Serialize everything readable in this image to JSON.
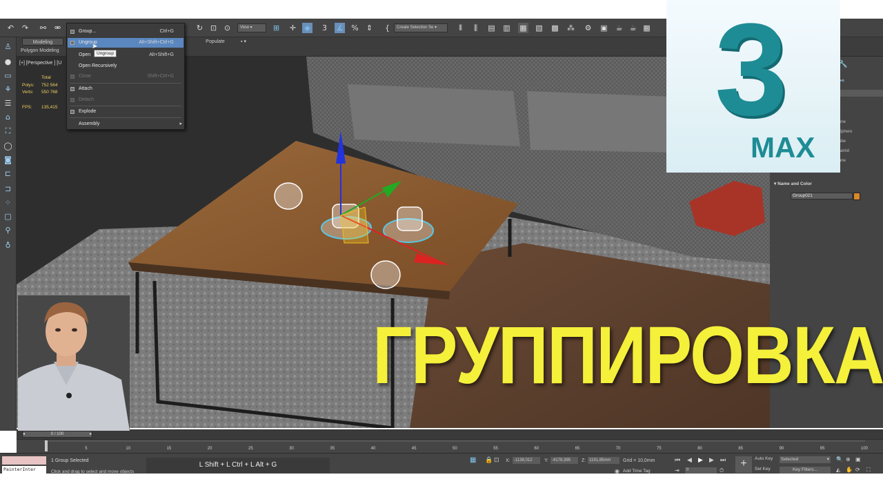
{
  "toolbar": {
    "view_select": "View",
    "selection_set": "Create Selection Se"
  },
  "ribbon": {
    "tab_modeling": "Modeling",
    "tab_populate": "Populate",
    "sub_polygon_modeling": "Polygon Modeling"
  },
  "viewport": {
    "label": "[+] [Perspective ] [U",
    "stats": {
      "header_total": "Total",
      "polys_label": "Polys:",
      "polys_value": "752 564",
      "verts_label": "Verts:",
      "verts_value": "550 768",
      "fps_label": "FPS:",
      "fps_value": "135,415"
    }
  },
  "group_menu": {
    "items": [
      {
        "label": "Group...",
        "shortcut": "Ctrl+G",
        "enabled": true,
        "highlighted": false
      },
      {
        "label": "Ungroup",
        "shortcut": "Alt+Shift+Ctrl+G",
        "enabled": true,
        "highlighted": true
      },
      {
        "label": "Open",
        "shortcut": "Alt+Shift+G",
        "enabled": true,
        "highlighted": false
      },
      {
        "label": "Open Recursively",
        "shortcut": "",
        "enabled": true,
        "highlighted": false
      },
      {
        "label": "Close",
        "shortcut": "Shift+Ctrl+G",
        "enabled": false,
        "highlighted": false
      },
      {
        "label": "Attach",
        "shortcut": "",
        "enabled": true,
        "highlighted": false
      },
      {
        "label": "Detach",
        "shortcut": "",
        "enabled": false,
        "highlighted": false
      },
      {
        "label": "Explode",
        "shortcut": "",
        "enabled": true,
        "highlighted": false
      },
      {
        "label": "Assembly",
        "shortcut": "",
        "enabled": true,
        "highlighted": false,
        "submenu": true
      }
    ],
    "tooltip": "Ungroup"
  },
  "command_panel": {
    "object_types": [
      "one",
      "Sphere",
      "ube",
      "ramid",
      "ane"
    ],
    "rollout_name_color": "Name and Color",
    "object_name": "Group021",
    "object_color": "#d8892a"
  },
  "timeline": {
    "slider": "0 / 100",
    "ticks": [
      "5",
      "10",
      "15",
      "20",
      "25",
      "30",
      "35",
      "40",
      "45",
      "50",
      "55",
      "60",
      "65",
      "70",
      "75",
      "80",
      "85",
      "90",
      "95",
      "100"
    ]
  },
  "status": {
    "maxscript_text": "PainterInter",
    "selection": "1 Group Selected",
    "prompt": "Click and drag to select and move objects",
    "shortcut_hint": "L Shift + L Ctrl + L Alt + G",
    "x_label": "X:",
    "x_value": "-1138,012",
    "y_label": "Y:",
    "y_value": "-4178,395",
    "z_label": "Z:",
    "z_value": "1191,85mm",
    "grid": "Grid = 10,0mm",
    "add_time_tag": "Add Time Tag",
    "auto_key": "Auto Key",
    "set_key": "Set Key",
    "key_mode": "Selected",
    "key_filters": "Key Filters...",
    "frame": "0"
  },
  "overlay": {
    "title": "ГРУППИРОВКА",
    "logo_number": "3",
    "logo_word": "MAX",
    "logo_color": "#1e8c95"
  }
}
